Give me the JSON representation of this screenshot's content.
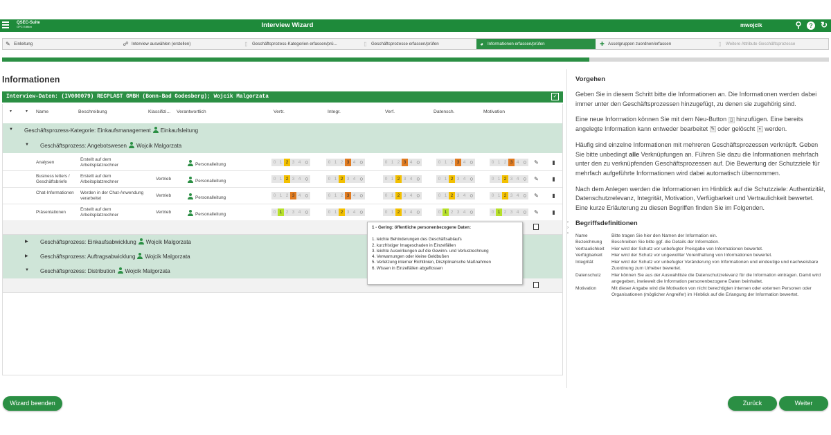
{
  "app": {
    "logo": "QSEC-Suite",
    "logo_sub": "GPC Edition",
    "title": "Interview Wizard",
    "user": "mwojcik"
  },
  "wizard": {
    "steps": [
      {
        "label": "Einleitung",
        "icon": "pencil-icon",
        "state": "done"
      },
      {
        "label": "Interview auswählen (erstellen)",
        "icon": "interview-icon",
        "state": "done"
      },
      {
        "label": "Geschäftsprozess-Kategorien erfassen/prü...",
        "icon": "page-icon",
        "state": "done"
      },
      {
        "label": "Geschäftsprozesse erfassen/prüfen",
        "icon": "page-icon",
        "state": "done"
      },
      {
        "label": "Informationen erfassen/prüfen",
        "icon": "globe-icon",
        "state": "active"
      },
      {
        "label": "Assetgruppen zuordnen/erfassen",
        "icon": "assets-icon",
        "state": "todo"
      },
      {
        "label": "Weitere Attribute Geschäftsprozesse",
        "icon": "page-icon",
        "state": "todo"
      }
    ],
    "progress": 0.71
  },
  "main": {
    "heading": "Informationen",
    "interview_bar": "Interview-Daten: (IV000079) RECPLAST GMBH (Bonn-Bad Godesberg); Wojcik Malgorzata",
    "columns": {
      "name": "Name",
      "beschreibung": "Beschreibung",
      "klassifi": "Klassifizi...",
      "verantwortlich": "Verantwortlich",
      "vertr": "Vertr.",
      "integr": "Integr.",
      "verf": "Verf.",
      "datensch": "Datensch.",
      "motivation": "Motivation"
    },
    "category": {
      "label": "Geschäftsprozess-Kategorie: Einkaufsmanagement",
      "owner": "Einkaufsleitung"
    },
    "process1": {
      "label": "Geschäftsprozess: Angebotswesen",
      "owner": "Wojcik Malgorzata"
    },
    "rows": [
      {
        "name": "Analysen",
        "desc": "Erstellt auf dem Arbeitsplatzrechner",
        "klass": "",
        "resp": "Personalleitung",
        "vertr": 2,
        "integr": 3,
        "verf": 3,
        "datensch": 3,
        "motivation": 3
      },
      {
        "name": "Business letters / Geschäftsbriefe",
        "desc": "Erstellt auf dem Arbeitsplatzrechner",
        "klass": "Vertrieb",
        "resp": "Personalleitung",
        "vertr": 2,
        "integr": 2,
        "verf": 2,
        "datensch": 2,
        "motivation": 2
      },
      {
        "name": "Chat-Informationen",
        "desc": "Werden in der Chat-Anwendung verarbeitet",
        "klass": "Vertrieb",
        "resp": "Personalleitung",
        "vertr": 3,
        "integr": 3,
        "verf": 2,
        "datensch": 2,
        "motivation": 2
      },
      {
        "name": "Präsentationen",
        "desc": "Erstellt auf dem Arbeitsplatzrechner",
        "klass": "Vertrieb",
        "resp": "Personalleitung",
        "vertr": 1,
        "integr": 2,
        "verf": 2,
        "datensch": 1,
        "motivation": 1
      }
    ],
    "processes": [
      {
        "label": "Geschäftsprozess: Einkaufsabwicklung",
        "owner": "Wojcik Malgorzata"
      },
      {
        "label": "Geschäftsprozess: Auftragsabwicklung",
        "owner": "Wojcik Malgorzata"
      },
      {
        "label": "Geschäftsprozess: Distribution",
        "owner": "Wojcik Malgorzata"
      }
    ],
    "scale_values": [
      "0",
      "1",
      "2",
      "3",
      "4"
    ]
  },
  "tooltip": {
    "title": "1 - Gering: öffentliche personenbezogene Daten:",
    "items": [
      "1. leichte Behinderungen des Geschäftsablaufs",
      "2. kurzfristiger Imageschaden in Einzelfällen",
      "3. leichte Auswirkungen auf die Gewinn- und Verlustrechnung",
      "4. Verwarnungen oder kleine Geldbußen",
      "5. Verletzung interner Richtlinien, Disziplinarische Maßnahmen",
      "6. Wissen in Einzelfällen abgeflossen"
    ]
  },
  "help": {
    "title": "Vorgehen",
    "p1": "Geben Sie in diesem Schritt bitte die Informationen an. Die Informationen werden dabei immer unter den Geschäftsprozessen hinzugefügt, zu denen sie zugehörig sind.",
    "p2a": "Eine neue Information können Sie mit dem Neu-Button",
    "p2b": "hinzufügen. Eine bereits angelegte Information kann entweder bearbeitet",
    "p2c": "oder gelöscht",
    "p2d": "werden.",
    "p3a": "Häufig sind einzelne Informationen mit mehreren Geschäftsprozessen verknüpft. Geben Sie bitte unbedingt",
    "p3b": "alle",
    "p3c": "Verknüpfungen an. Führen Sie dazu die Informationen mehrfach unter den zu verknüpfenden Geschäftsprozessen auf. Die Bewertung der Schutzziele für mehrfach aufgeführte Informationen wird dabei automatisch übernommen.",
    "p4": "Nach dem Anlegen werden die Informationen im Hinblick auf die Schutzziele: Authentizität, Datenschutzrelevanz, Integrität, Motivation, Verfügbarkeit und Vertraulichkeit bewertet. Eine kurze Erläuterung zu diesen Begriffen finden Sie im Folgenden.",
    "defs_title": "Begriffsdefinitionen",
    "defs": [
      {
        "t": "Name",
        "d": "Bitte tragen Sie hier den Namen der Information ein."
      },
      {
        "t": "Bezeichnung",
        "d": "Beschreiben Sie bitte ggf. die Details der Information."
      },
      {
        "t": "Vertraulichkeit",
        "d": "Hier wird der Schutz vor unbefugter Preisgabe von Informationen bewertet."
      },
      {
        "t": "Verfügbarkeit",
        "d": "Hier wird der Schutz vor ungewollter Vorenthaltung von Informationen bewertet."
      },
      {
        "t": "Integrität",
        "d": "Hier wird der Schutz vor unbefugter Veränderung von Informationen und eindeutige und nachweisbare Zuordnung zum Urheber bewertet."
      },
      {
        "t": "Datenschutz",
        "d": "Hier können Sie aus der Auswahlliste die Datenschutzrelevanz für die Information eintragen. Damit wird angegeben, inwieweit die Information personenbezogene Daten beinhaltet."
      },
      {
        "t": "Motivation",
        "d": "Mit dieser Angabe wird die Motivation von nicht berechtigten internen oder externen Personen oder Organisationen (möglicher Angreifer) im Hinblick auf die Erlangung der Information bewertet."
      }
    ]
  },
  "buttons": {
    "finish": "Wizard beenden",
    "back": "Zurück",
    "next": "Weiter"
  },
  "colors": {
    "primary": "#2b8f44",
    "topbar": "#1e8a3a",
    "group_row": "#cfe5d8",
    "level1": "#b6e02a",
    "level2": "#f3c000",
    "level3": "#e07b20"
  }
}
